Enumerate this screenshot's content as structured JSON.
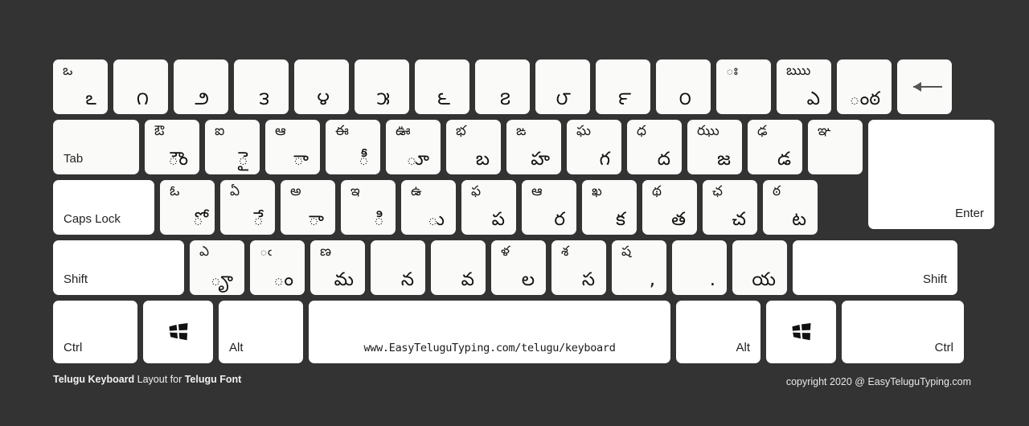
{
  "meta": {
    "background_color": "#333333",
    "key_color": "#fafaf8",
    "key_color_bright": "#ffffff",
    "glyph_color": "#111111"
  },
  "footer": {
    "left_bold_1": "Telugu Keyboard",
    "left_plain": " Layout for ",
    "left_bold_2": "Telugu Font",
    "right": "copyright 2020 @ EasyTeluguTyping.com"
  },
  "spacebar": {
    "url": "www.EasyTeluguTyping.com/telugu/keyboard"
  },
  "rows": {
    "number_row": [
      {
        "name": "key-backquote",
        "top": "ఒ",
        "bottom": "ఽ"
      },
      {
        "name": "key-1",
        "single": "౧"
      },
      {
        "name": "key-2",
        "single": "౨"
      },
      {
        "name": "key-3",
        "single": "౩"
      },
      {
        "name": "key-4",
        "single": "౪"
      },
      {
        "name": "key-5",
        "single": "౫"
      },
      {
        "name": "key-6",
        "single": "౬"
      },
      {
        "name": "key-7",
        "single": "౭"
      },
      {
        "name": "key-8",
        "single": "౮"
      },
      {
        "name": "key-9",
        "single": "౯"
      },
      {
        "name": "key-0",
        "single": "౦"
      },
      {
        "name": "key-minus",
        "top": "ః"
      },
      {
        "name": "key-equal",
        "top": "ఋు",
        "bottom": "ఎ"
      },
      {
        "name": "key-bracket-extra",
        "bottom": "ంఠ"
      },
      {
        "name": "key-backspace",
        "label": "",
        "icon": "arrow-left-icon"
      }
    ],
    "tab_row": [
      {
        "name": "key-tab",
        "label": "Tab"
      },
      {
        "name": "key-q",
        "top": "ఔ",
        "bottom": "ౌం"
      },
      {
        "name": "key-w",
        "top": "ఐ",
        "bottom": "ై"
      },
      {
        "name": "key-e",
        "top": "ఆ",
        "bottom": "ా"
      },
      {
        "name": "key-r",
        "top": "ఈ",
        "bottom": "ీ"
      },
      {
        "name": "key-t",
        "top": "ఊ",
        "bottom": "ూ"
      },
      {
        "name": "key-y",
        "top": "భ",
        "bottom": "బ"
      },
      {
        "name": "key-u",
        "top": "ఙ",
        "bottom": "హ"
      },
      {
        "name": "key-i",
        "top": "ఘ",
        "bottom": "గ"
      },
      {
        "name": "key-o",
        "top": "ధ",
        "bottom": "ద"
      },
      {
        "name": "key-p",
        "top": "ఝు",
        "bottom": "జ"
      },
      {
        "name": "key-bracket-left",
        "top": "ఢ",
        "bottom": "డ"
      },
      {
        "name": "key-bracket-right",
        "top": "ఞ"
      },
      {
        "name": "key-backslash",
        "label": ""
      }
    ],
    "caps_row": [
      {
        "name": "key-caps-lock",
        "label": "Caps Lock"
      },
      {
        "name": "key-a",
        "top": "ఓ",
        "bottom": "ో"
      },
      {
        "name": "key-s",
        "top": "ఏ",
        "bottom": "ే"
      },
      {
        "name": "key-d",
        "top": "అ",
        "bottom": "ా"
      },
      {
        "name": "key-f",
        "top": "ఇ",
        "bottom": "ి"
      },
      {
        "name": "key-g",
        "top": "ఉ",
        "bottom": "ు"
      },
      {
        "name": "key-h",
        "top": "ఫ",
        "bottom": "ప"
      },
      {
        "name": "key-j",
        "top": "ఆ",
        "bottom": "ర"
      },
      {
        "name": "key-k",
        "top": "ఖ",
        "bottom": "క"
      },
      {
        "name": "key-l",
        "top": "థ",
        "bottom": "త"
      },
      {
        "name": "key-semicolon",
        "top": "ఛ",
        "bottom": "చ"
      },
      {
        "name": "key-quote",
        "top": "ఠ",
        "bottom": "ట"
      },
      {
        "name": "key-enter",
        "label": "Enter"
      }
    ],
    "shift_row": [
      {
        "name": "key-shift-left",
        "label": "Shift"
      },
      {
        "name": "key-z",
        "top": "ఎ",
        "bottom": "ౄ"
      },
      {
        "name": "key-x",
        "top": "ఁ",
        "bottom": "ం"
      },
      {
        "name": "key-c",
        "top": "ణ",
        "bottom": "మ"
      },
      {
        "name": "key-v",
        "bottom": "న"
      },
      {
        "name": "key-b",
        "bottom": "వ"
      },
      {
        "name": "key-n",
        "top": "ళ",
        "bottom": "ల"
      },
      {
        "name": "key-m",
        "top": "శ",
        "bottom": "స"
      },
      {
        "name": "key-comma",
        "top": "ష",
        "bottom": ","
      },
      {
        "name": "key-period",
        "bottom": "."
      },
      {
        "name": "key-slash",
        "bottom": "య"
      },
      {
        "name": "key-shift-right",
        "label": "Shift"
      }
    ],
    "bottom_row": [
      {
        "name": "key-ctrl-left",
        "label": "Ctrl"
      },
      {
        "name": "key-win-left",
        "label": "",
        "icon": "windows-icon"
      },
      {
        "name": "key-alt-left",
        "label": "Alt"
      },
      {
        "name": "key-space",
        "label": ""
      },
      {
        "name": "key-alt-right",
        "label": "Alt"
      },
      {
        "name": "key-win-right",
        "label": "",
        "icon": "windows-icon"
      },
      {
        "name": "key-ctrl-right",
        "label": "Ctrl"
      }
    ]
  }
}
